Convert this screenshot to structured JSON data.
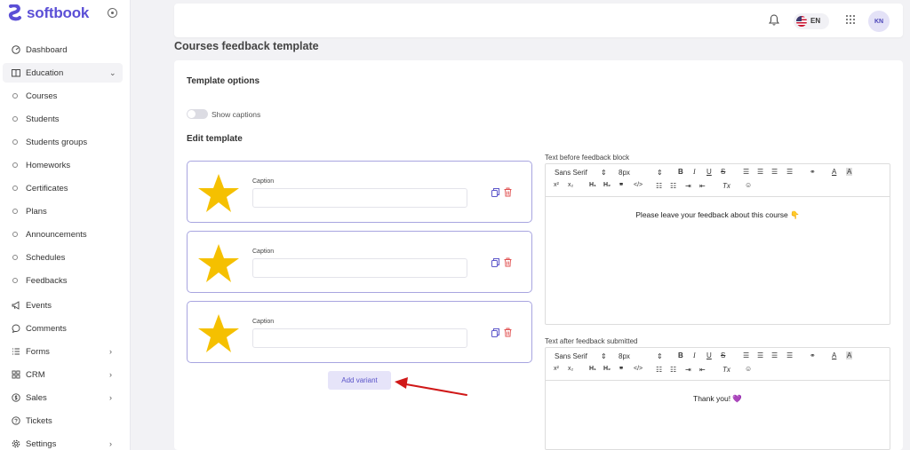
{
  "brand": {
    "name": "softbook",
    "accent": "#5b4fd6"
  },
  "sidebar": {
    "items": [
      {
        "label": "Dashboard",
        "icon": "dashboard-icon",
        "type": "main"
      },
      {
        "label": "Education",
        "icon": "book-icon",
        "type": "main",
        "active": true,
        "chevron": "⌄"
      },
      {
        "label": "Courses",
        "type": "sub"
      },
      {
        "label": "Students",
        "type": "sub"
      },
      {
        "label": "Students groups",
        "type": "sub"
      },
      {
        "label": "Homeworks",
        "type": "sub"
      },
      {
        "label": "Certificates",
        "type": "sub"
      },
      {
        "label": "Plans",
        "type": "sub"
      },
      {
        "label": "Announcements",
        "type": "sub"
      },
      {
        "label": "Schedules",
        "type": "sub"
      },
      {
        "label": "Feedbacks",
        "type": "sub"
      },
      {
        "label": "Events",
        "icon": "megaphone-icon",
        "type": "main"
      },
      {
        "label": "Comments",
        "icon": "comment-icon",
        "type": "main"
      },
      {
        "label": "Forms",
        "icon": "list-icon",
        "type": "main",
        "chevron": "›"
      },
      {
        "label": "CRM",
        "icon": "grid-icon",
        "type": "main",
        "chevron": "›"
      },
      {
        "label": "Sales",
        "icon": "dollar-icon",
        "type": "main",
        "chevron": "›"
      },
      {
        "label": "Tickets",
        "icon": "help-icon",
        "type": "main"
      },
      {
        "label": "Settings",
        "icon": "gear-icon",
        "type": "main",
        "chevron": "›"
      }
    ]
  },
  "topbar": {
    "language": "EN",
    "avatar_initials": "KN"
  },
  "page": {
    "title": "Courses feedback template"
  },
  "template_options": {
    "title": "Template options",
    "show_captions_label": "Show captions",
    "show_captions": false
  },
  "edit_template": {
    "title": "Edit template",
    "variants": [
      {
        "caption_label": "Caption",
        "caption_value": ""
      },
      {
        "caption_label": "Caption",
        "caption_value": ""
      },
      {
        "caption_label": "Caption",
        "caption_value": ""
      }
    ],
    "add_variant_label": "Add variant",
    "star_color": "#f5c000"
  },
  "editor_toolbar": {
    "font": "Sans Serif",
    "size": "8px",
    "row1_icons": [
      "bold-icon",
      "italic-icon",
      "underline-icon",
      "strikethrough-icon",
      "align-left-icon",
      "align-center-icon",
      "align-right-icon",
      "align-justify-icon",
      "link-icon",
      "text-color-icon",
      "background-color-icon"
    ],
    "row2_icons": [
      "superscript-icon",
      "subscript-icon",
      "heading1-icon",
      "heading2-icon",
      "blockquote-icon",
      "code-icon",
      "ordered-list-icon",
      "bullet-list-icon",
      "indent-icon",
      "outdent-icon",
      "clear-format-icon",
      "emoji-icon"
    ]
  },
  "editors": {
    "before": {
      "label": "Text before feedback block",
      "content": "Please leave your feedback about this course 👇"
    },
    "after": {
      "label": "Text after feedback submitted",
      "content": "Thank you! 💜"
    }
  }
}
